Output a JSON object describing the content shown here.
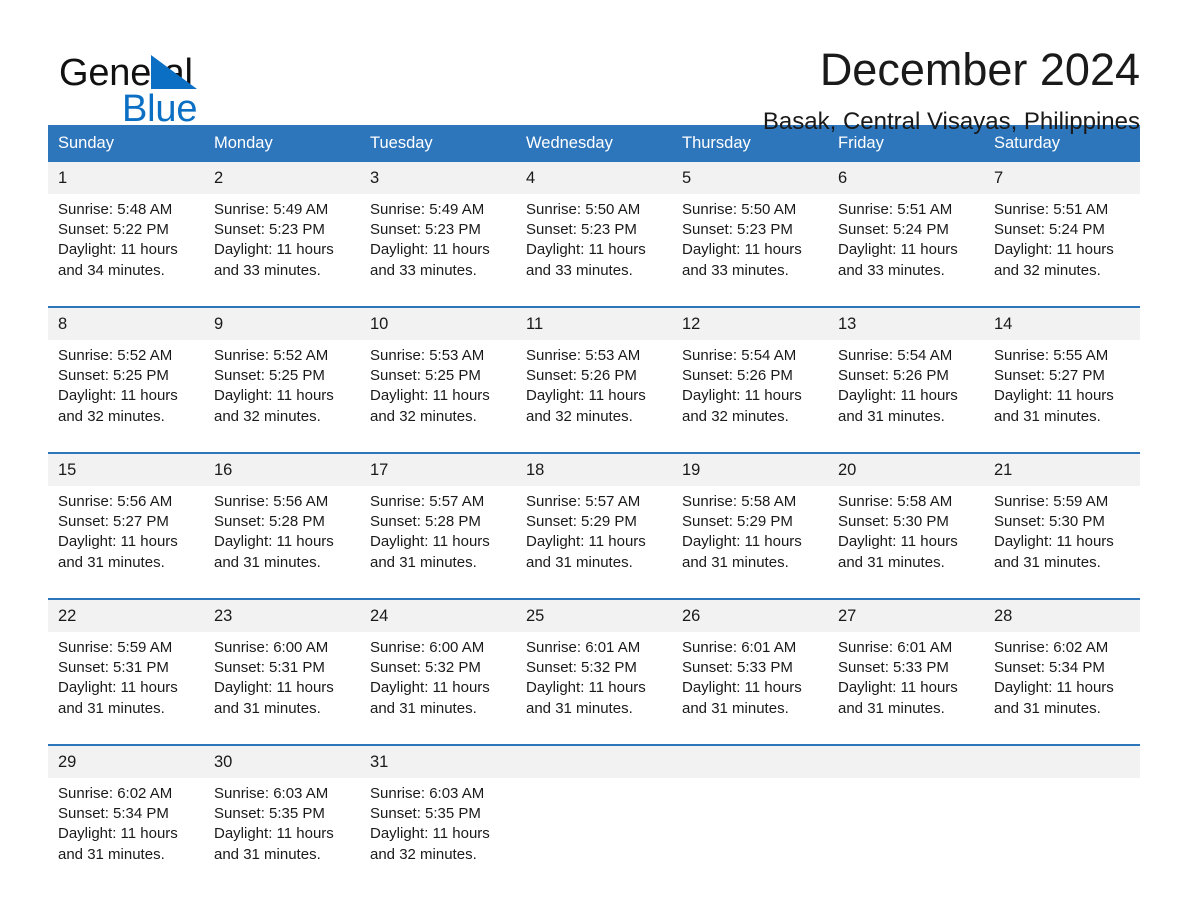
{
  "brand": {
    "word_one": "General",
    "word_two": "Blue",
    "triangle_color": "#0b6fc4"
  },
  "header": {
    "month_title": "December 2024",
    "location": "Basak, Central Visayas, Philippines"
  },
  "theme": {
    "header_blue": "#2e76bc",
    "row_divider_blue": "#2e76bc",
    "date_band_gray": "#f2f2f2",
    "text_color": "#1a1a1a"
  },
  "calendar": {
    "weekday_headers": [
      "Sunday",
      "Monday",
      "Tuesday",
      "Wednesday",
      "Thursday",
      "Friday",
      "Saturday"
    ],
    "weeks": [
      {
        "days": [
          {
            "num": "1",
            "sunrise": "Sunrise: 5:48 AM",
            "sunset": "Sunset: 5:22 PM",
            "daylight": "Daylight: 11 hours and 34 minutes."
          },
          {
            "num": "2",
            "sunrise": "Sunrise: 5:49 AM",
            "sunset": "Sunset: 5:23 PM",
            "daylight": "Daylight: 11 hours and 33 minutes."
          },
          {
            "num": "3",
            "sunrise": "Sunrise: 5:49 AM",
            "sunset": "Sunset: 5:23 PM",
            "daylight": "Daylight: 11 hours and 33 minutes."
          },
          {
            "num": "4",
            "sunrise": "Sunrise: 5:50 AM",
            "sunset": "Sunset: 5:23 PM",
            "daylight": "Daylight: 11 hours and 33 minutes."
          },
          {
            "num": "5",
            "sunrise": "Sunrise: 5:50 AM",
            "sunset": "Sunset: 5:23 PM",
            "daylight": "Daylight: 11 hours and 33 minutes."
          },
          {
            "num": "6",
            "sunrise": "Sunrise: 5:51 AM",
            "sunset": "Sunset: 5:24 PM",
            "daylight": "Daylight: 11 hours and 33 minutes."
          },
          {
            "num": "7",
            "sunrise": "Sunrise: 5:51 AM",
            "sunset": "Sunset: 5:24 PM",
            "daylight": "Daylight: 11 hours and 32 minutes."
          }
        ]
      },
      {
        "days": [
          {
            "num": "8",
            "sunrise": "Sunrise: 5:52 AM",
            "sunset": "Sunset: 5:25 PM",
            "daylight": "Daylight: 11 hours and 32 minutes."
          },
          {
            "num": "9",
            "sunrise": "Sunrise: 5:52 AM",
            "sunset": "Sunset: 5:25 PM",
            "daylight": "Daylight: 11 hours and 32 minutes."
          },
          {
            "num": "10",
            "sunrise": "Sunrise: 5:53 AM",
            "sunset": "Sunset: 5:25 PM",
            "daylight": "Daylight: 11 hours and 32 minutes."
          },
          {
            "num": "11",
            "sunrise": "Sunrise: 5:53 AM",
            "sunset": "Sunset: 5:26 PM",
            "daylight": "Daylight: 11 hours and 32 minutes."
          },
          {
            "num": "12",
            "sunrise": "Sunrise: 5:54 AM",
            "sunset": "Sunset: 5:26 PM",
            "daylight": "Daylight: 11 hours and 32 minutes."
          },
          {
            "num": "13",
            "sunrise": "Sunrise: 5:54 AM",
            "sunset": "Sunset: 5:26 PM",
            "daylight": "Daylight: 11 hours and 31 minutes."
          },
          {
            "num": "14",
            "sunrise": "Sunrise: 5:55 AM",
            "sunset": "Sunset: 5:27 PM",
            "daylight": "Daylight: 11 hours and 31 minutes."
          }
        ]
      },
      {
        "days": [
          {
            "num": "15",
            "sunrise": "Sunrise: 5:56 AM",
            "sunset": "Sunset: 5:27 PM",
            "daylight": "Daylight: 11 hours and 31 minutes."
          },
          {
            "num": "16",
            "sunrise": "Sunrise: 5:56 AM",
            "sunset": "Sunset: 5:28 PM",
            "daylight": "Daylight: 11 hours and 31 minutes."
          },
          {
            "num": "17",
            "sunrise": "Sunrise: 5:57 AM",
            "sunset": "Sunset: 5:28 PM",
            "daylight": "Daylight: 11 hours and 31 minutes."
          },
          {
            "num": "18",
            "sunrise": "Sunrise: 5:57 AM",
            "sunset": "Sunset: 5:29 PM",
            "daylight": "Daylight: 11 hours and 31 minutes."
          },
          {
            "num": "19",
            "sunrise": "Sunrise: 5:58 AM",
            "sunset": "Sunset: 5:29 PM",
            "daylight": "Daylight: 11 hours and 31 minutes."
          },
          {
            "num": "20",
            "sunrise": "Sunrise: 5:58 AM",
            "sunset": "Sunset: 5:30 PM",
            "daylight": "Daylight: 11 hours and 31 minutes."
          },
          {
            "num": "21",
            "sunrise": "Sunrise: 5:59 AM",
            "sunset": "Sunset: 5:30 PM",
            "daylight": "Daylight: 11 hours and 31 minutes."
          }
        ]
      },
      {
        "days": [
          {
            "num": "22",
            "sunrise": "Sunrise: 5:59 AM",
            "sunset": "Sunset: 5:31 PM",
            "daylight": "Daylight: 11 hours and 31 minutes."
          },
          {
            "num": "23",
            "sunrise": "Sunrise: 6:00 AM",
            "sunset": "Sunset: 5:31 PM",
            "daylight": "Daylight: 11 hours and 31 minutes."
          },
          {
            "num": "24",
            "sunrise": "Sunrise: 6:00 AM",
            "sunset": "Sunset: 5:32 PM",
            "daylight": "Daylight: 11 hours and 31 minutes."
          },
          {
            "num": "25",
            "sunrise": "Sunrise: 6:01 AM",
            "sunset": "Sunset: 5:32 PM",
            "daylight": "Daylight: 11 hours and 31 minutes."
          },
          {
            "num": "26",
            "sunrise": "Sunrise: 6:01 AM",
            "sunset": "Sunset: 5:33 PM",
            "daylight": "Daylight: 11 hours and 31 minutes."
          },
          {
            "num": "27",
            "sunrise": "Sunrise: 6:01 AM",
            "sunset": "Sunset: 5:33 PM",
            "daylight": "Daylight: 11 hours and 31 minutes."
          },
          {
            "num": "28",
            "sunrise": "Sunrise: 6:02 AM",
            "sunset": "Sunset: 5:34 PM",
            "daylight": "Daylight: 11 hours and 31 minutes."
          }
        ]
      },
      {
        "days": [
          {
            "num": "29",
            "sunrise": "Sunrise: 6:02 AM",
            "sunset": "Sunset: 5:34 PM",
            "daylight": "Daylight: 11 hours and 31 minutes."
          },
          {
            "num": "30",
            "sunrise": "Sunrise: 6:03 AM",
            "sunset": "Sunset: 5:35 PM",
            "daylight": "Daylight: 11 hours and 31 minutes."
          },
          {
            "num": "31",
            "sunrise": "Sunrise: 6:03 AM",
            "sunset": "Sunset: 5:35 PM",
            "daylight": "Daylight: 11 hours and 32 minutes."
          },
          {
            "num": "",
            "sunrise": "",
            "sunset": "",
            "daylight": ""
          },
          {
            "num": "",
            "sunrise": "",
            "sunset": "",
            "daylight": ""
          },
          {
            "num": "",
            "sunrise": "",
            "sunset": "",
            "daylight": ""
          },
          {
            "num": "",
            "sunrise": "",
            "sunset": "",
            "daylight": ""
          }
        ]
      }
    ]
  }
}
